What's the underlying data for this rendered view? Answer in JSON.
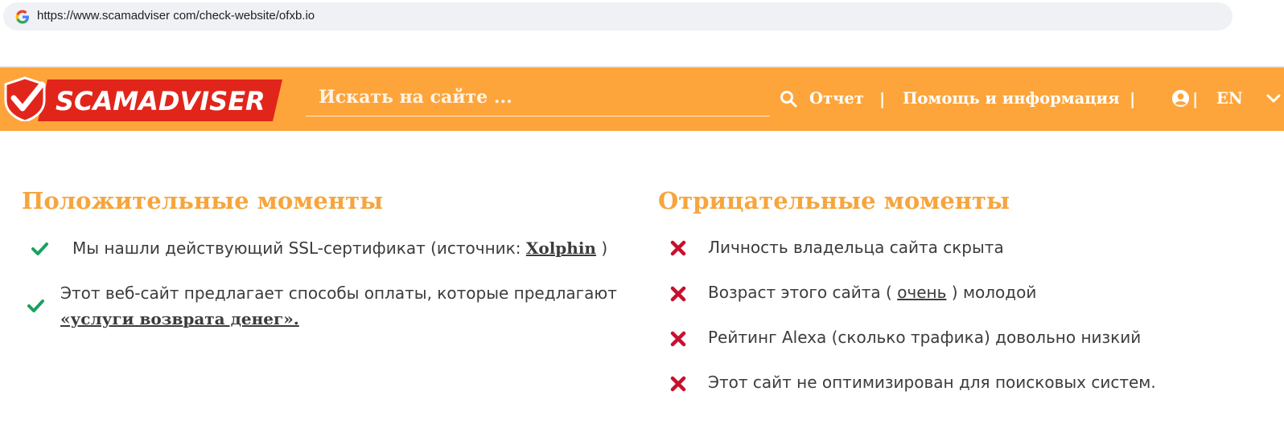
{
  "browser": {
    "url": "https://www.scamadviser com/check-website/ofxb.io"
  },
  "header": {
    "logo_text": "SCAMADVISER",
    "search_placeholder": "Искать на сайте ...",
    "nav": {
      "report": "Отчет",
      "help": "Помощь и информация",
      "lang": "EN",
      "separator": "|"
    },
    "colors": {
      "bar": "#fda53b",
      "logo_red": "#e1251b"
    }
  },
  "positives": {
    "title": "Положительные моменты",
    "items": [
      {
        "before": "Мы нашли действующий SSL-сертификат (источник: ",
        "link": "Xolphin",
        "after": " )"
      },
      {
        "line1": "Этот веб-сайт предлагает способы оплаты, которые предлагают",
        "link": "«услуги возврата денег»."
      }
    ]
  },
  "negatives": {
    "title": "Отрицательные моменты",
    "items": [
      {
        "text": "Личность владельца сайта скрыта"
      },
      {
        "before": "Возраст этого сайта ( ",
        "link": "очень",
        "after": " ) молодой"
      },
      {
        "text": "Рейтинг Alexa (сколько трафика) довольно низкий"
      },
      {
        "text": "Этот сайт не оптимизирован для поисковых систем."
      }
    ]
  },
  "icons": {
    "positive": "check-icon",
    "negative": "cross-icon",
    "search": "search-icon",
    "user": "user-icon"
  }
}
